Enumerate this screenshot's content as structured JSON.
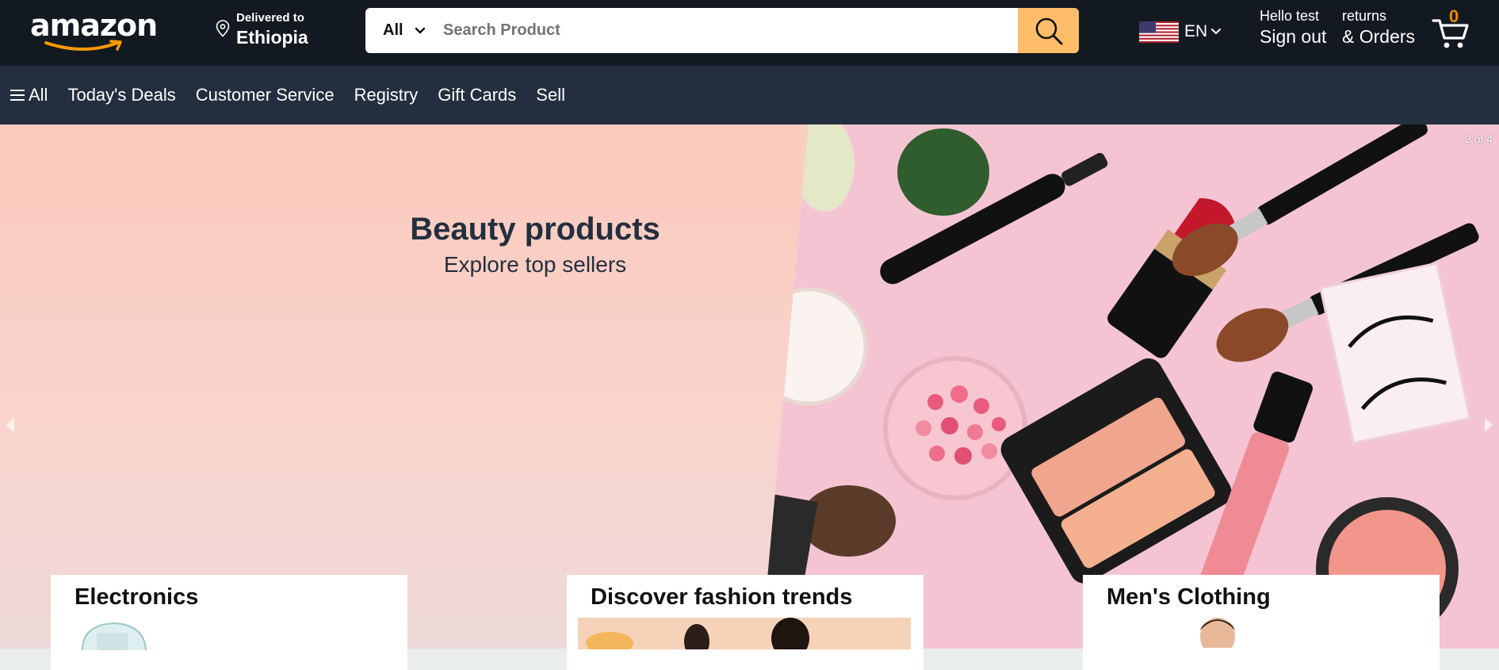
{
  "header": {
    "logo_text": "amazon",
    "deliver_line1": "Delivered to",
    "deliver_line2": "Ethiopia",
    "search_category": "All",
    "search_placeholder": "Search Product",
    "language": "EN",
    "account_line1": "Hello test",
    "account_line2": "Sign out",
    "orders_line1": "returns",
    "orders_line2": "& Orders",
    "cart_count": "0"
  },
  "nav": {
    "all_label": "All",
    "items": [
      "Today's Deals",
      "Customer Service",
      "Registry",
      "Gift Cards",
      "Sell"
    ]
  },
  "hero": {
    "title": "Beauty products",
    "subtitle": "Explore top sellers",
    "counter": "2 of 4"
  },
  "cards": [
    {
      "title": "Electronics"
    },
    {
      "title": "Discover fashion trends"
    },
    {
      "title": "Men's Clothing"
    }
  ],
  "colors": {
    "header_bg": "#131921",
    "nav_bg": "#232f3e",
    "search_button": "#febd69",
    "cart_count": "#f08804",
    "hero_left": "#f8cfc4",
    "hero_right": "#f5c4d3"
  }
}
